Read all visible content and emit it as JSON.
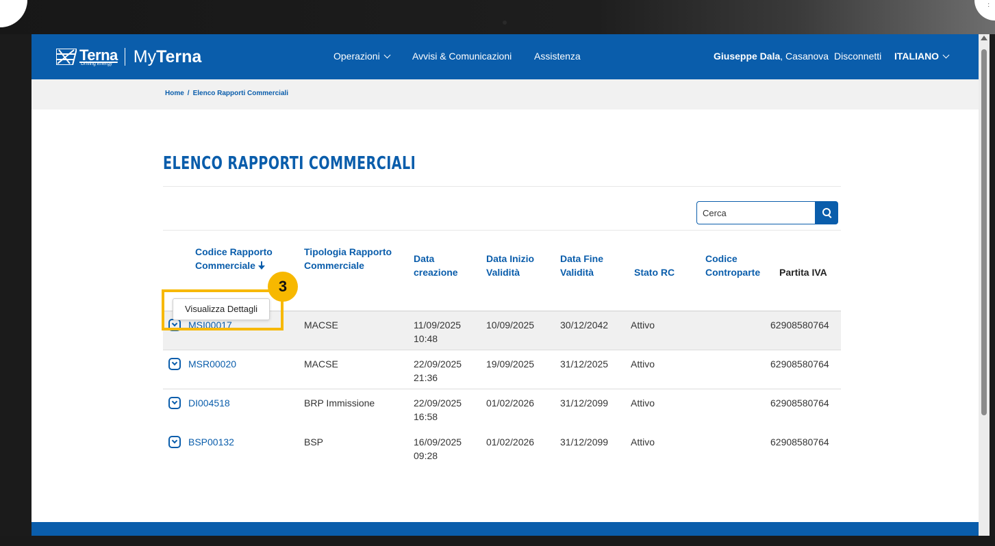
{
  "header": {
    "logo_brand": "Terna",
    "logo_tagline": "Driving Energy",
    "logo_product_prefix": "My",
    "logo_product_name": "Terna",
    "nav": [
      "Operazioni",
      "Avvisi & Comunicazioni",
      "Assistenza"
    ],
    "user_name": "Giuseppe Dala",
    "user_location": ", Casanova",
    "logout": "Disconnetti",
    "language": "ITALIANO"
  },
  "breadcrumb": {
    "home": "Home",
    "separator": "/",
    "current": "Elenco Rapporti Commerciali"
  },
  "page_title": "ELENCO RAPPORTI COMMERCIALI",
  "search": {
    "placeholder": "Cerca"
  },
  "table": {
    "columns": [
      [
        "Codice Rapporto",
        "Commerciale"
      ],
      [
        "Tipologia Rapporto",
        "Commerciale"
      ],
      [
        "Data",
        "creazione"
      ],
      [
        "Data Inizio",
        "Validità"
      ],
      [
        "Data Fine",
        "Validità"
      ],
      [
        "Stato RC"
      ],
      [
        "Codice",
        "Controparte"
      ],
      [
        "Partita IVA"
      ]
    ],
    "rows": [
      {
        "code": "MSI00017",
        "type": "MACSE",
        "created_date": "11/09/2025",
        "created_time": "10:48",
        "start": "10/09/2025",
        "end": "30/12/2042",
        "status": "Attivo",
        "counterpart": "",
        "vat": "62908580764"
      },
      {
        "code": "MSR00020",
        "type": "MACSE",
        "created_date": "22/09/2025",
        "created_time": "21:36",
        "start": "19/09/2025",
        "end": "31/12/2025",
        "status": "Attivo",
        "counterpart": "",
        "vat": "62908580764"
      },
      {
        "code": "DI004518",
        "type": "BRP Immissione",
        "created_date": "22/09/2025",
        "created_time": "16:58",
        "start": "01/02/2026",
        "end": "31/12/2099",
        "status": "Attivo",
        "counterpart": "",
        "vat": "62908580764"
      },
      {
        "code": "BSP00132",
        "type": "BSP",
        "created_date": "16/09/2025",
        "created_time": "09:28",
        "start": "01/02/2026",
        "end": "31/12/2099",
        "status": "Attivo",
        "counterpart": "",
        "vat": "62908580764"
      }
    ]
  },
  "popup": {
    "label": "Visualizza Dettagli"
  },
  "annotation": {
    "step_number": "3",
    "color": "#f7b800"
  },
  "colors": {
    "brand_blue": "#0a5dab",
    "breadcrumb_bg": "#f1f1f1"
  }
}
